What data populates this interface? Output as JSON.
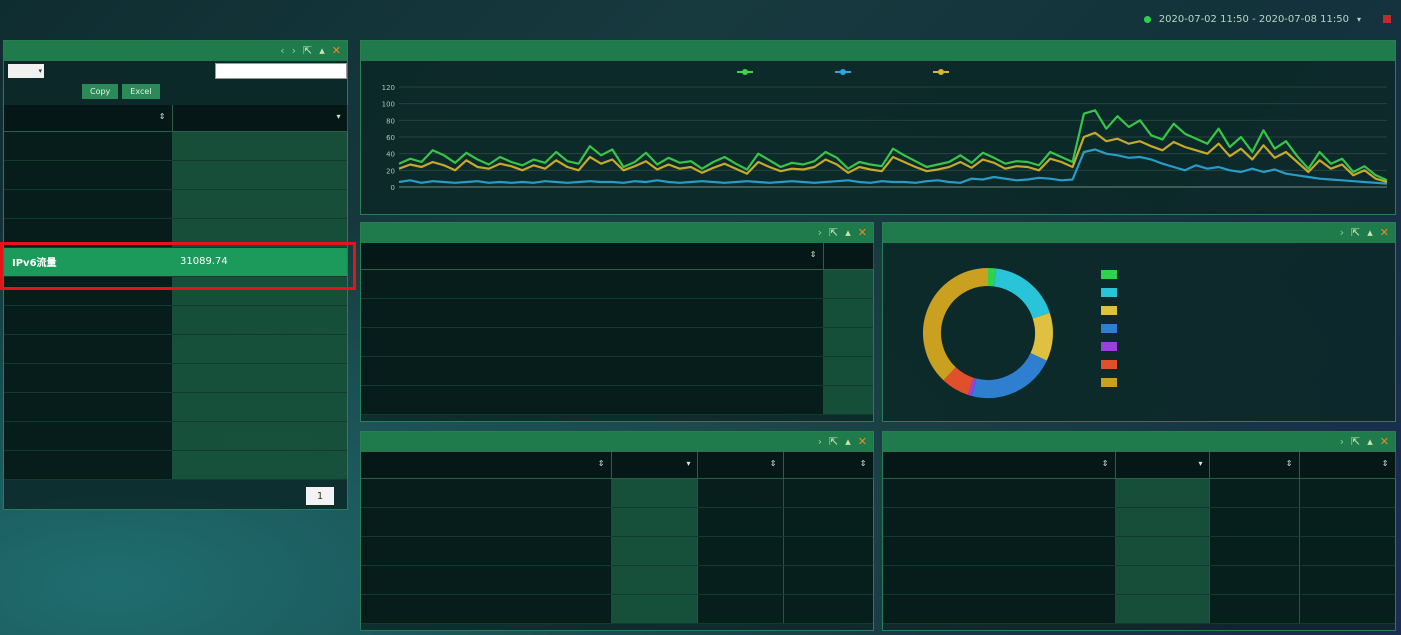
{
  "topbar": {
    "status_dot_color": "#2bd34f",
    "time_range": "2020-07-02 11:50 - 2020-07-08 11:50"
  },
  "sidebar": {
    "title": "",
    "page_size": "",
    "per_page_label": "",
    "search_label": "",
    "copy_label": "Copy",
    "excel_label": "Excel",
    "col_name": "",
    "col_value": "",
    "rows": [
      {
        "name": "",
        "value": ""
      },
      {
        "name": "",
        "value": ""
      },
      {
        "name": "",
        "value": ""
      },
      {
        "name": "",
        "value": ""
      },
      {
        "name": "IPv6流量",
        "value": "31089.74"
      },
      {
        "name": "",
        "value": ""
      },
      {
        "name": "",
        "value": ""
      },
      {
        "name": "",
        "value": ""
      },
      {
        "name": "",
        "value": ""
      },
      {
        "name": "",
        "value": ""
      },
      {
        "name": "",
        "value": ""
      },
      {
        "name": "",
        "value": ""
      }
    ],
    "footer_info": "",
    "prev_label": "",
    "page_current": "1",
    "next_label": ""
  },
  "network": {
    "title": "",
    "unit_label": "",
    "legend": [
      {
        "label": "",
        "color": "#3cd64b"
      },
      {
        "label": "",
        "color": "#2aa8d8"
      },
      {
        "label": "",
        "color": "#d8b72a"
      }
    ],
    "chart_data": {
      "type": "line",
      "ylim": [
        0,
        120
      ],
      "yticks": [
        0,
        20,
        40,
        60,
        80,
        100,
        120
      ],
      "x_start_label": "",
      "x_end_label": "",
      "series": [
        {
          "color": "#3cd64b",
          "values": [
            28,
            34,
            30,
            44,
            38,
            29,
            41,
            33,
            27,
            36,
            30,
            26,
            33,
            29,
            42,
            31,
            28,
            49,
            38,
            45,
            24,
            30,
            41,
            27,
            35,
            29,
            31,
            22,
            30,
            36,
            28,
            21,
            40,
            32,
            24,
            29,
            27,
            31,
            42,
            35,
            22,
            30,
            27,
            25,
            46,
            38,
            31,
            24,
            27,
            30,
            38,
            29,
            41,
            35,
            28,
            31,
            30,
            26,
            42,
            36,
            30,
            88,
            92,
            70,
            85,
            72,
            80,
            62,
            57,
            76,
            64,
            58,
            52,
            70,
            48,
            60,
            42,
            68,
            46,
            55,
            37,
            22,
            42,
            28,
            34,
            18,
            25,
            14,
            8
          ]
        },
        {
          "color": "#2aa8d8",
          "values": [
            6,
            8,
            5,
            7,
            6,
            5,
            6,
            7,
            5,
            6,
            5,
            6,
            5,
            7,
            6,
            5,
            6,
            7,
            6,
            6,
            5,
            7,
            6,
            8,
            6,
            5,
            6,
            7,
            6,
            5,
            6,
            7,
            6,
            5,
            6,
            7,
            6,
            5,
            6,
            7,
            8,
            6,
            5,
            7,
            6,
            6,
            5,
            7,
            8,
            6,
            5,
            10,
            9,
            12,
            10,
            8,
            9,
            11,
            10,
            8,
            9,
            42,
            45,
            40,
            38,
            35,
            36,
            33,
            28,
            24,
            20,
            26,
            22,
            24,
            20,
            18,
            22,
            18,
            21,
            16,
            14,
            12,
            10,
            9,
            8,
            7,
            6,
            5,
            4
          ]
        },
        {
          "color": "#d8b72a",
          "values": [
            22,
            27,
            24,
            30,
            26,
            20,
            32,
            24,
            22,
            28,
            25,
            20,
            26,
            22,
            32,
            24,
            20,
            36,
            28,
            33,
            20,
            25,
            31,
            21,
            27,
            22,
            24,
            17,
            23,
            28,
            22,
            16,
            30,
            24,
            19,
            22,
            21,
            24,
            33,
            27,
            17,
            24,
            21,
            19,
            36,
            30,
            24,
            19,
            21,
            24,
            30,
            23,
            33,
            29,
            22,
            25,
            24,
            20,
            34,
            30,
            24,
            60,
            65,
            55,
            58,
            52,
            55,
            49,
            44,
            54,
            48,
            44,
            40,
            52,
            37,
            46,
            33,
            50,
            35,
            42,
            30,
            18,
            32,
            22,
            27,
            14,
            20,
            10,
            6
          ]
        }
      ]
    }
  },
  "ipv6_pairs": {
    "title": "",
    "col_pair": "",
    "col_value": "",
    "rows": [
      {
        "pair": "",
        "value": ""
      },
      {
        "pair": "",
        "value": ""
      },
      {
        "pair": "",
        "value": ""
      },
      {
        "pair": "",
        "value": ""
      },
      {
        "pair": "",
        "value": ""
      }
    ]
  },
  "app": {
    "title": "",
    "chart_data": {
      "type": "pie",
      "donut": true,
      "slices": [
        {
          "label": "",
          "value": 2,
          "color": "#2bd34f"
        },
        {
          "label": "",
          "value": 18,
          "color": "#29c4d8"
        },
        {
          "label": "",
          "value": 12,
          "color": "#e0c040"
        },
        {
          "label": "",
          "value": 22,
          "color": "#2e7fd0"
        },
        {
          "label": "",
          "value": 1,
          "color": "#9b3fe0"
        },
        {
          "label": "",
          "value": 7,
          "color": "#e0502a"
        },
        {
          "label": "",
          "value": 38,
          "color": "#c9a020"
        }
      ]
    }
  },
  "server": {
    "title": "",
    "cols": [
      "",
      "",
      "",
      ""
    ],
    "rows": [
      {
        "ip": "",
        "total": "",
        "out": "",
        "in": ""
      },
      {
        "ip": "",
        "total": "",
        "out": "",
        "in": ""
      },
      {
        "ip": "",
        "total": "",
        "out": "",
        "in": ""
      },
      {
        "ip": "",
        "total": "",
        "out": "",
        "in": ""
      },
      {
        "ip": "",
        "total": "",
        "out": "",
        "in": ""
      }
    ]
  },
  "client": {
    "title": "",
    "cols": [
      "",
      "",
      "",
      ""
    ],
    "rows": [
      {
        "ip": "",
        "total": "",
        "out": "",
        "in": ""
      },
      {
        "ip": "",
        "total": "",
        "out": "",
        "in": ""
      },
      {
        "ip": "",
        "total": "",
        "out": "",
        "in": ""
      },
      {
        "ip": "",
        "total": "",
        "out": "",
        "in": ""
      },
      {
        "ip": "",
        "total": "",
        "out": "",
        "in": ""
      }
    ]
  }
}
